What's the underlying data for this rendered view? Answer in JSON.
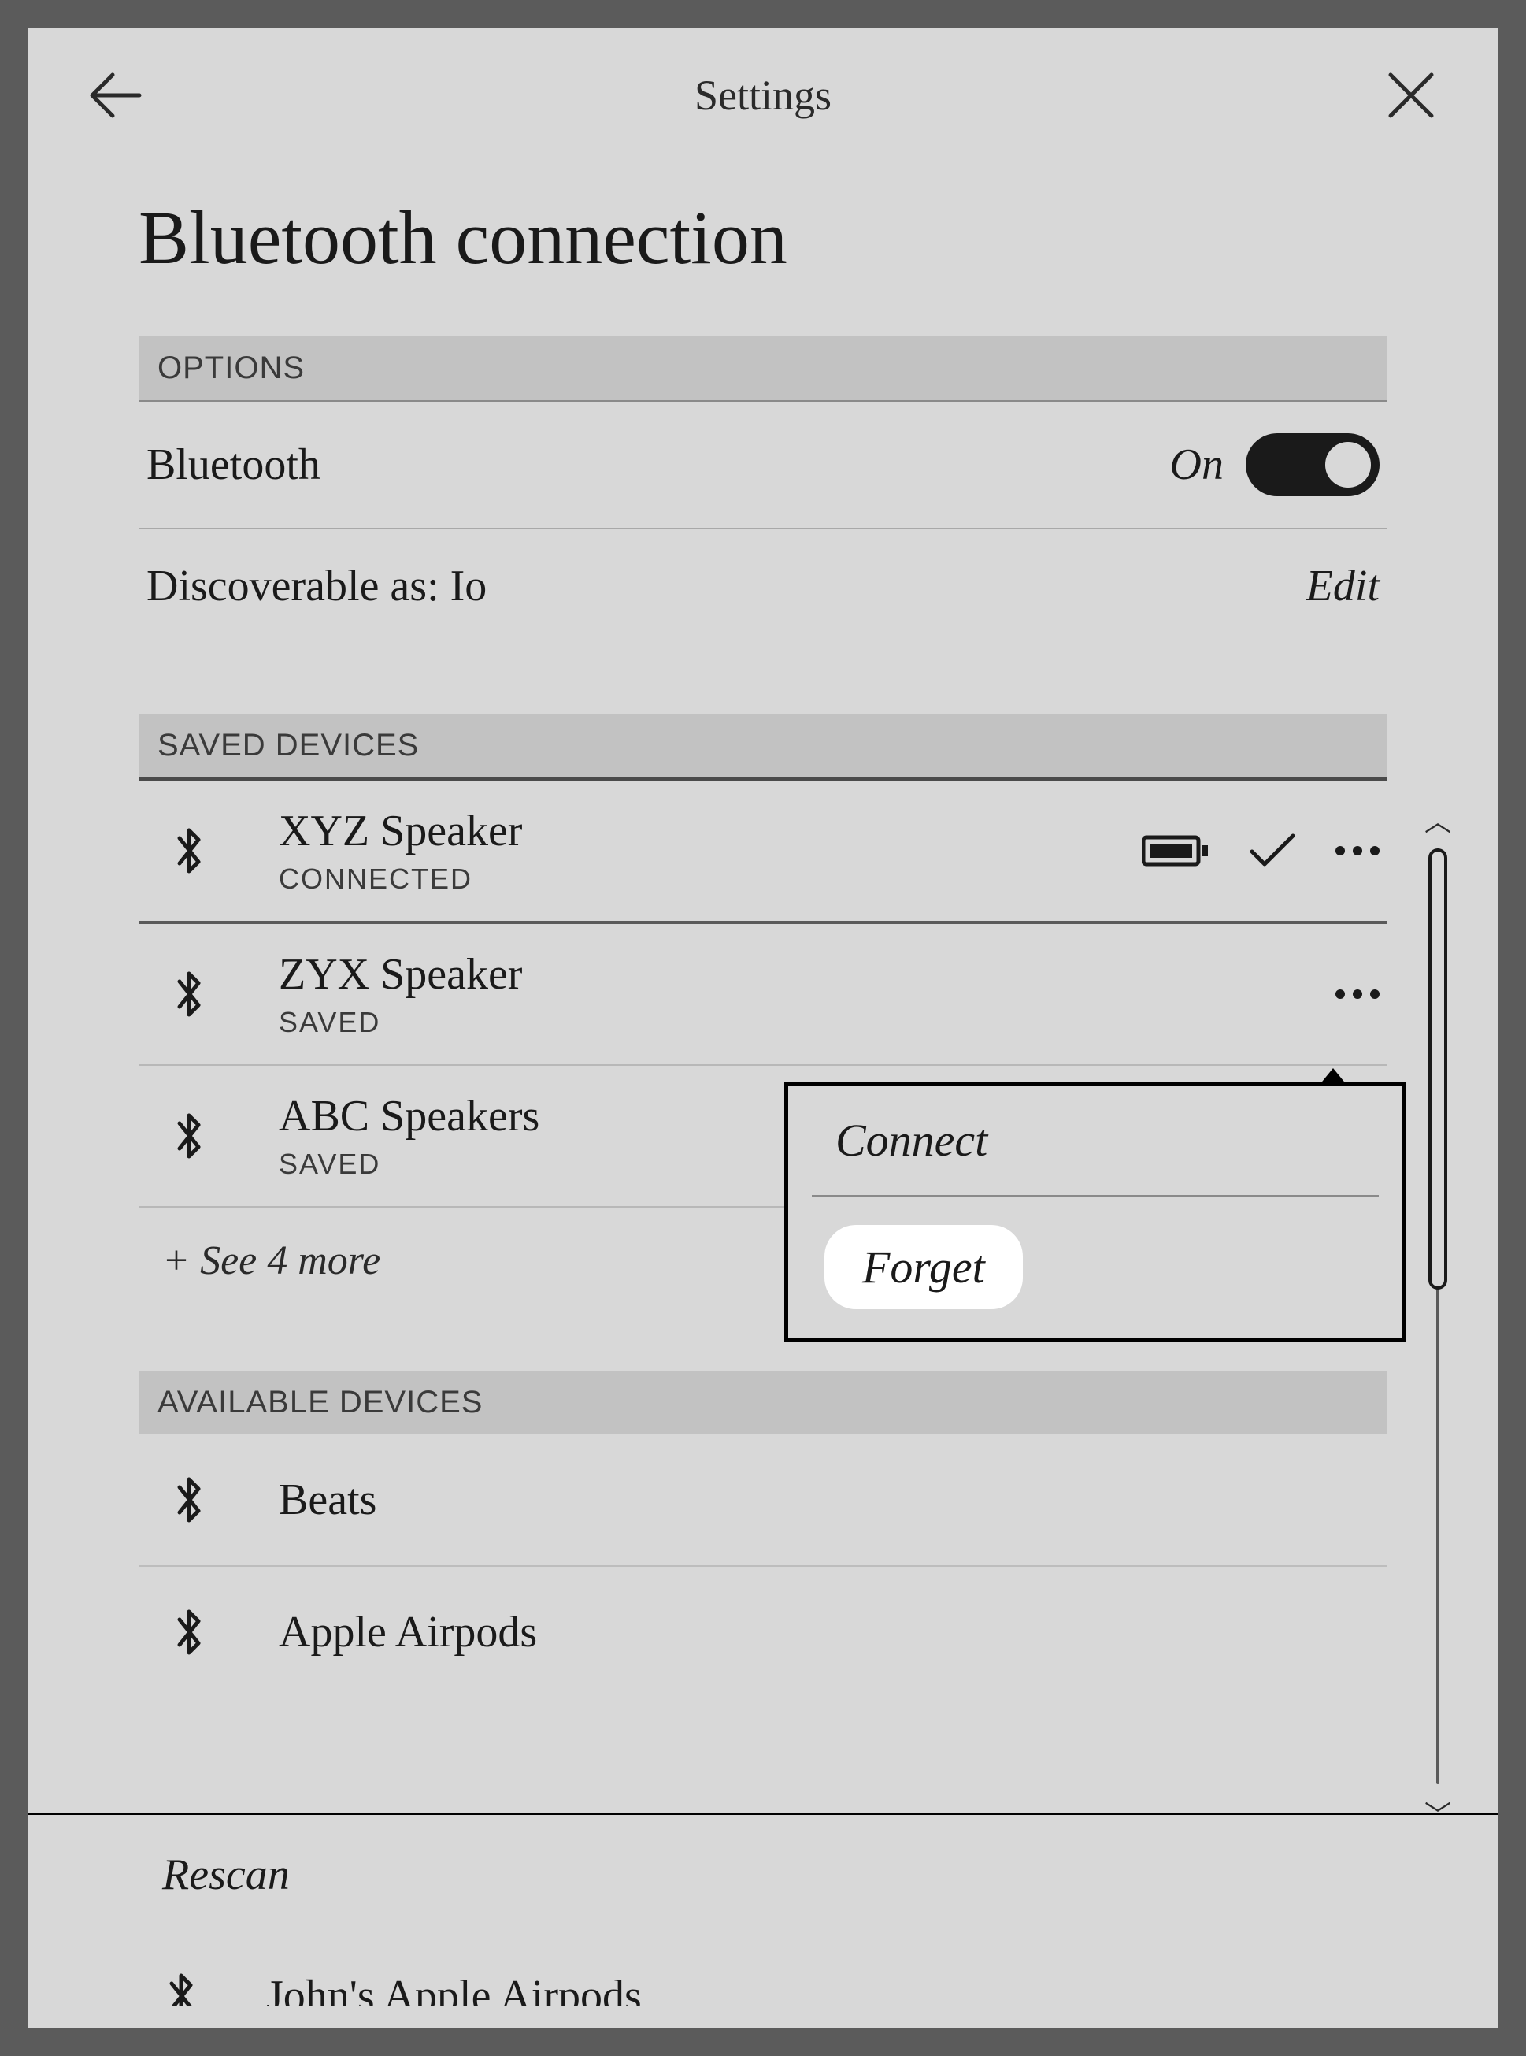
{
  "header": {
    "title": "Settings"
  },
  "page": {
    "title": "Bluetooth connection"
  },
  "sections": {
    "options_label": "OPTIONS",
    "saved_label": "SAVED DEVICES",
    "available_label": "AVAILABLE DEVICES"
  },
  "options": {
    "bluetooth_label": "Bluetooth",
    "bluetooth_state": "On",
    "discoverable_label": "Discoverable as: Io",
    "edit_label": "Edit"
  },
  "saved_devices": [
    {
      "name": "XYZ Speaker",
      "status": "CONNECTED",
      "battery": true,
      "connected": true
    },
    {
      "name": "ZYX Speaker",
      "status": "SAVED",
      "battery": false,
      "connected": false
    },
    {
      "name": "ABC Speakers",
      "status": "SAVED",
      "battery": false,
      "connected": false
    }
  ],
  "see_more": "+ See 4 more",
  "available_devices": [
    {
      "name": "Beats"
    },
    {
      "name": "Apple Airpods"
    },
    {
      "name": "John's Apple Airpods"
    }
  ],
  "popup": {
    "connect": "Connect",
    "forget": "Forget"
  },
  "rescan": "Rescan"
}
